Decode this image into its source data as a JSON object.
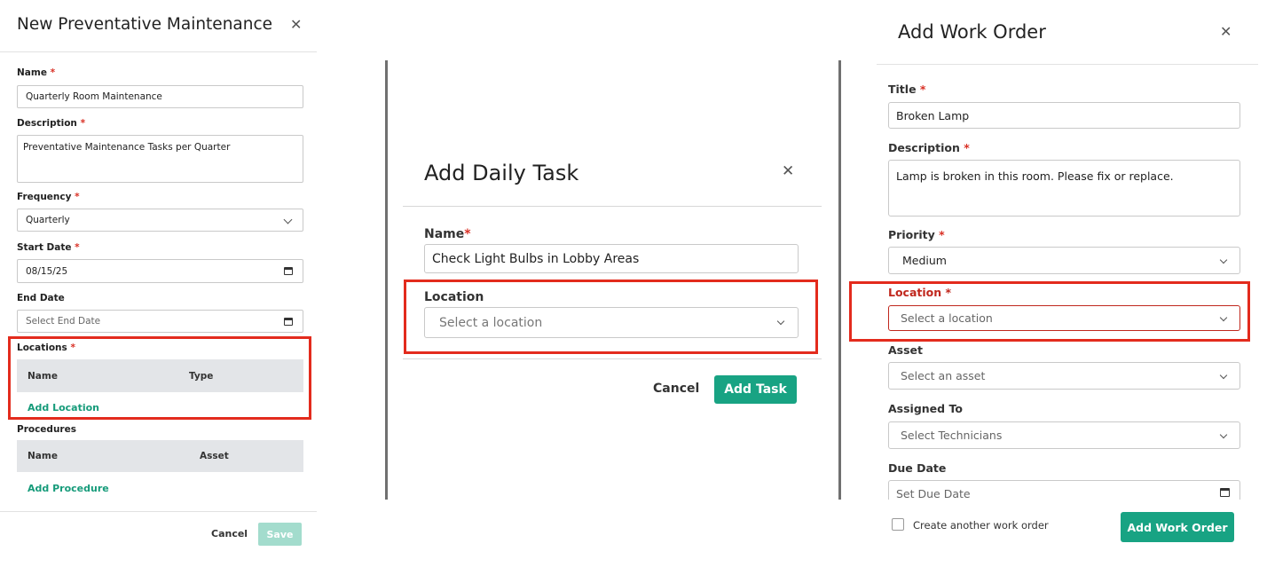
{
  "pm_panel": {
    "title": "New Preventative Maintenance",
    "required_mark": "*",
    "name_label": "Name",
    "name_value": "Quarterly Room Maintenance",
    "description_label": "Description",
    "description_value": "Preventative Maintenance Tasks per Quarter",
    "frequency_label": "Frequency",
    "frequency_value": "Quarterly",
    "start_date_label": "Start Date",
    "start_date_value": "08/15/25",
    "end_date_label": "End Date",
    "end_date_placeholder": "Select End Date",
    "locations_label": "Locations",
    "locations_columns": [
      "Name",
      "Type"
    ],
    "add_location_label": "Add Location",
    "procedures_label": "Procedures",
    "procedures_columns": [
      "Name",
      "Asset"
    ],
    "add_procedure_label": "Add Procedure",
    "cancel_label": "Cancel",
    "save_label": "Save"
  },
  "daily_task_panel": {
    "title": "Add Daily Task",
    "name_label": "Name",
    "required_mark": "*",
    "name_value": "Check Light Bulbs in Lobby Areas",
    "location_label": "Location",
    "location_placeholder": "Select a location",
    "cancel_label": "Cancel",
    "submit_label": "Add Task"
  },
  "work_order_panel": {
    "title": "Add Work Order",
    "required_mark": "*",
    "title_label": "Title",
    "title_value": "Broken Lamp",
    "description_label": "Description",
    "description_value": "Lamp is broken in this room. Please fix or replace.",
    "priority_label": "Priority",
    "priority_value": "Medium",
    "location_label": "Location",
    "location_placeholder": "Select a location",
    "asset_label": "Asset",
    "asset_placeholder": "Select an asset",
    "assigned_to_label": "Assigned To",
    "assigned_to_placeholder": "Select Technicians",
    "due_date_label": "Due Date",
    "due_date_placeholder": "Set Due Date",
    "create_another_label": "Create another work order",
    "submit_label": "Add Work Order"
  },
  "colors": {
    "accent_green": "#18a383",
    "highlight_red": "#e32b1d",
    "required_red": "#d93025",
    "table_header_gray": "#e3e5e8"
  }
}
